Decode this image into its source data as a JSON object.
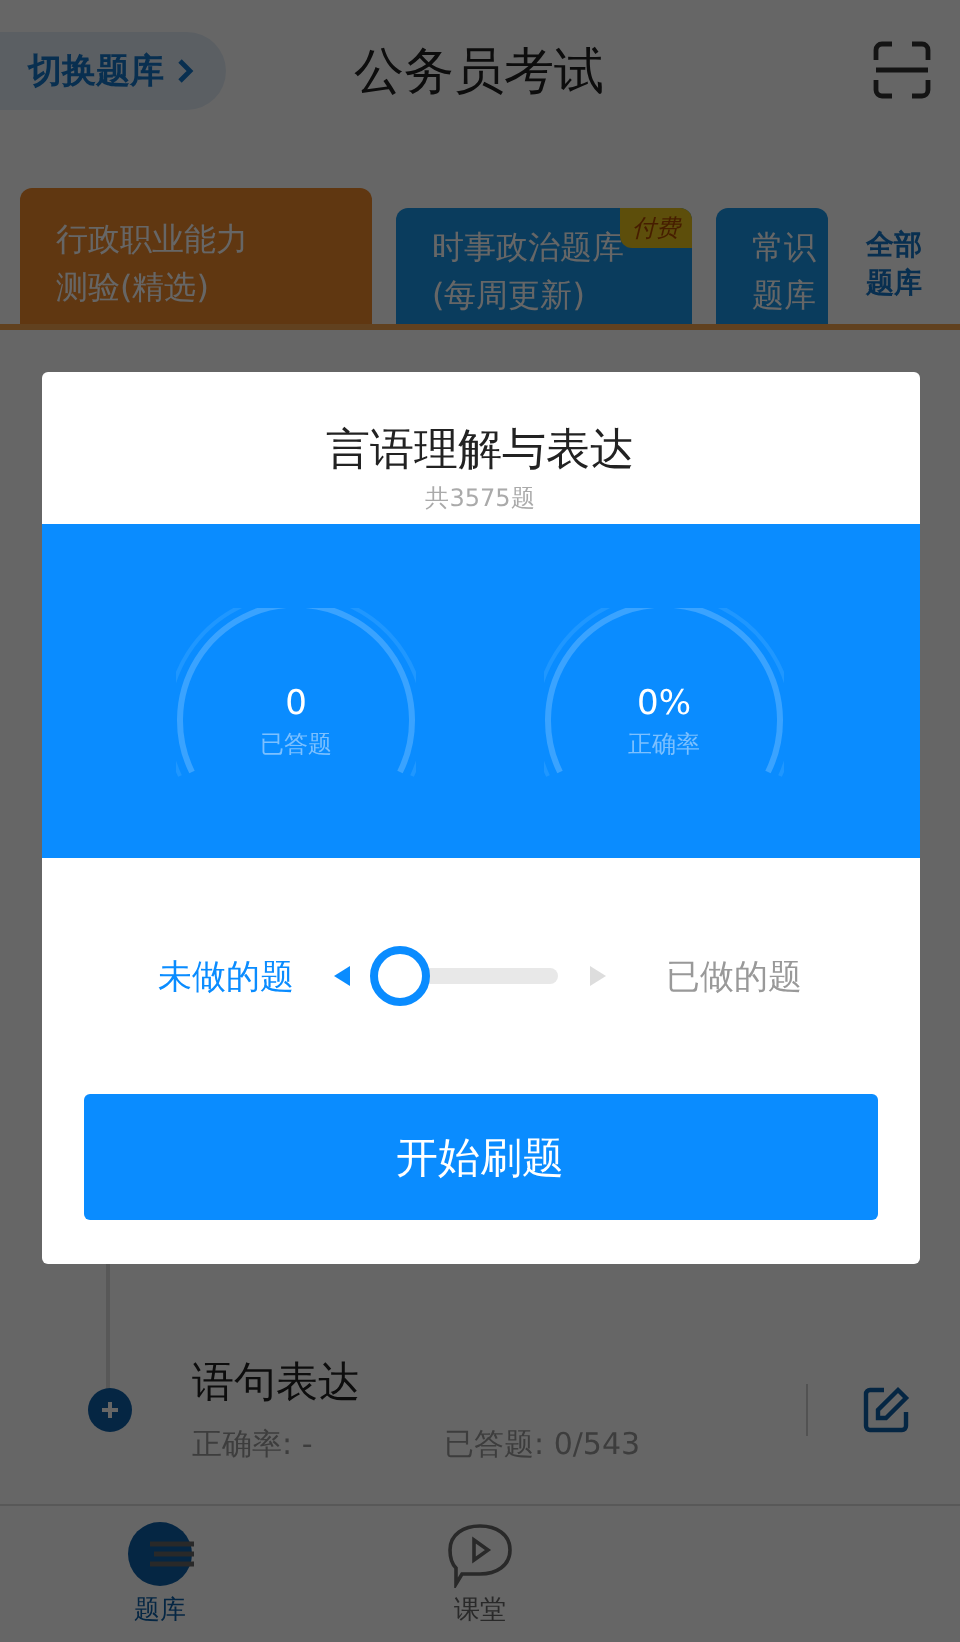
{
  "header": {
    "switch_button": "切换题库",
    "title": "公务员考试"
  },
  "banks": [
    {
      "lines": [
        "行政职业能力",
        "测验(精选)"
      ],
      "selected": true
    },
    {
      "lines": [
        "时事政治题库",
        "(每周更新)"
      ],
      "selected": false,
      "badge": "付费"
    },
    {
      "lines": [
        "常识",
        "题库"
      ],
      "selected": false
    }
  ],
  "all_banks_button": "全部题库",
  "chapters": [
    {
      "name": "语句表达",
      "accuracy": "正确率: -",
      "answered": "已答题: 0/543"
    }
  ],
  "bottom_nav": [
    {
      "label": "题库",
      "selected": true,
      "kind": "bank"
    },
    {
      "label": "课堂",
      "selected": false,
      "kind": "class"
    }
  ],
  "dialog": {
    "title": "言语理解与表达",
    "subtitle": "共3575题",
    "stats": [
      {
        "value": "0",
        "label": "已答题"
      },
      {
        "value": "0%",
        "label": "正确率"
      }
    ],
    "mode_options": [
      {
        "label": "未做的题",
        "selected": true
      },
      {
        "label": "已做的题",
        "selected": false
      }
    ],
    "start_button": "开始刷题"
  }
}
